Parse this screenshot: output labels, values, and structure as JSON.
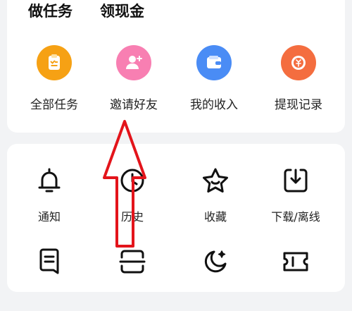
{
  "tasks_section": {
    "title_do_tasks": "做任务",
    "title_claim_cash": "领现金",
    "items": [
      {
        "label": "全部任务",
        "icon": "task-list-icon",
        "color": "#f6a114"
      },
      {
        "label": "邀请好友",
        "icon": "add-friend-icon",
        "color": "#f87fb2"
      },
      {
        "label": "我的收入",
        "icon": "wallet-icon",
        "color": "#4a8cf5"
      },
      {
        "label": "提现记录",
        "icon": "withdraw-record-icon",
        "color": "#f46d3f"
      }
    ]
  },
  "tools_section": {
    "items": [
      {
        "label": "通知",
        "icon": "bell-icon"
      },
      {
        "label": "历史",
        "icon": "history-icon"
      },
      {
        "label": "收藏",
        "icon": "star-icon"
      },
      {
        "label": "下载/离线",
        "icon": "download-icon"
      },
      {
        "label": "",
        "icon": "bookmark-icon"
      },
      {
        "label": "",
        "icon": "scan-icon"
      },
      {
        "label": "",
        "icon": "night-mode-icon"
      },
      {
        "label": "",
        "icon": "ticket-icon"
      }
    ]
  },
  "annotation": {
    "color": "#e3141b",
    "icon": "red-arrow-pointer"
  }
}
